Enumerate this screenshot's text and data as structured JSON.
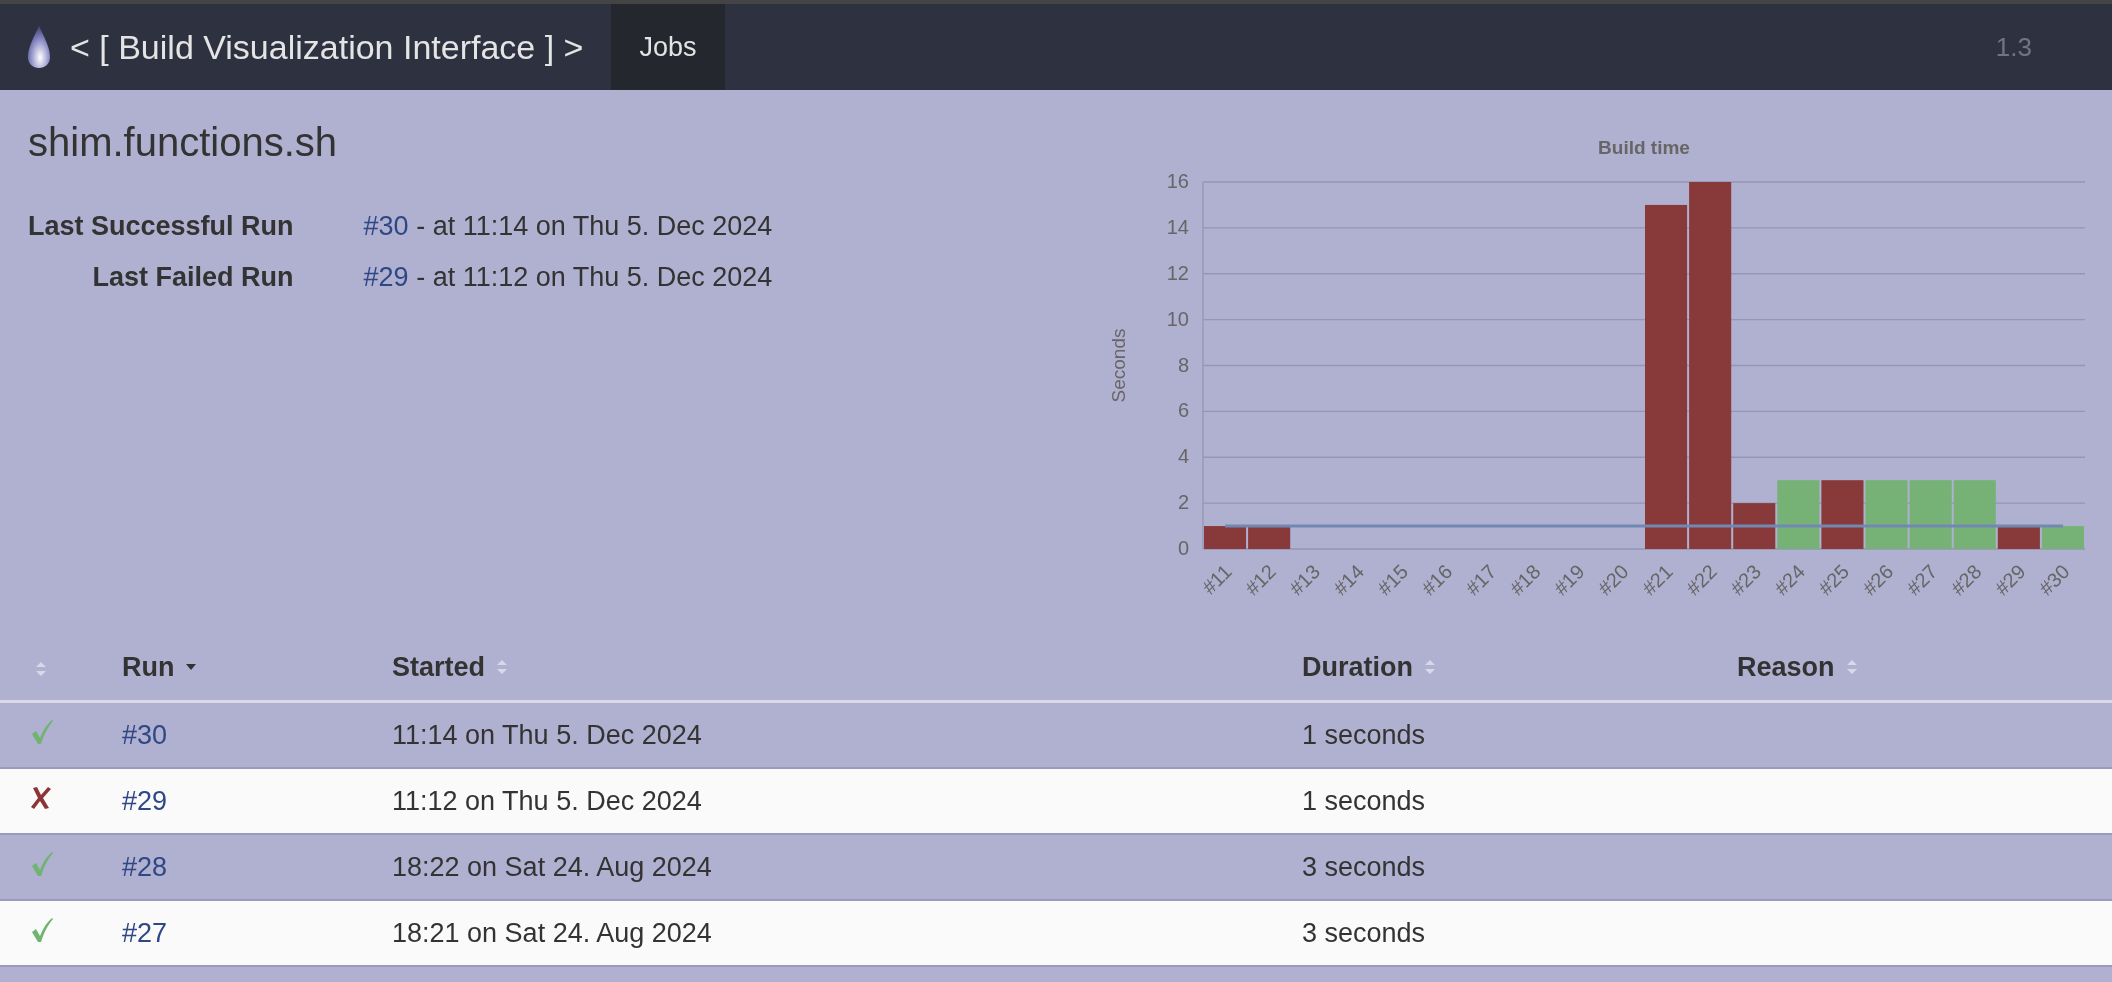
{
  "header": {
    "title": "< [ Build Visualization Interface ] >",
    "nav": [
      {
        "label": "Jobs",
        "selected": true
      }
    ],
    "version": "1.3"
  },
  "job": {
    "name": "shim.functions.sh",
    "summary": [
      {
        "label": "Last Successful Run",
        "run": "#30",
        "text": " - at 11:14 on Thu 5. Dec 2024"
      },
      {
        "label": "Last Failed Run",
        "run": "#29",
        "text": " - at 11:12 on Thu 5. Dec 2024"
      }
    ]
  },
  "chart_data": {
    "type": "bar",
    "title": "Build time",
    "ylabel": "Seconds",
    "stacked": true,
    "categories": [
      "#11",
      "#12",
      "#13",
      "#14",
      "#15",
      "#16",
      "#17",
      "#18",
      "#19",
      "#20",
      "#21",
      "#22",
      "#23",
      "#24",
      "#25",
      "#26",
      "#27",
      "#28",
      "#29",
      "#30"
    ],
    "series": [
      {
        "color": "#883a3a",
        "values": [
          1,
          1,
          0,
          0,
          0,
          0,
          0,
          0,
          0,
          0,
          15,
          16,
          2,
          null,
          3,
          null,
          null,
          null,
          1,
          null
        ]
      },
      {
        "color": "#76b276",
        "values": [
          null,
          null,
          null,
          null,
          null,
          null,
          null,
          null,
          null,
          null,
          null,
          null,
          null,
          3,
          null,
          3,
          3,
          3,
          null,
          1
        ]
      },
      {
        "type": "line",
        "color": "#7288b4",
        "values": [
          1,
          1,
          1,
          1,
          1,
          1,
          1,
          1,
          1,
          1,
          1,
          1,
          1,
          1,
          1,
          1,
          1,
          1,
          1,
          1
        ]
      }
    ],
    "ylim": [
      0,
      16
    ],
    "yticks": [
      0,
      2,
      4,
      6,
      8,
      10,
      12,
      14,
      16
    ],
    "grid": true
  },
  "table": {
    "columns": [
      {
        "sorted": false
      },
      {
        "label": "Run",
        "sorted": true
      },
      {
        "label": "Started",
        "sorted": false
      },
      {
        "label": "Duration",
        "sorted": false
      },
      {
        "label": "Reason",
        "sorted": false
      }
    ],
    "rows": [
      {
        "success": true,
        "run": "#30",
        "started": "11:14 on Thu 5. Dec 2024",
        "duration": "1 seconds"
      },
      {
        "success": false,
        "run": "#29",
        "started": "11:12 on Thu 5. Dec 2024",
        "duration": "1 seconds"
      },
      {
        "success": true,
        "run": "#28",
        "started": "18:22 on Sat 24. Aug 2024",
        "duration": "3 seconds"
      },
      {
        "success": true,
        "run": "#27",
        "started": "18:21 on Sat 24. Aug 2024",
        "duration": "3 seconds"
      }
    ]
  }
}
